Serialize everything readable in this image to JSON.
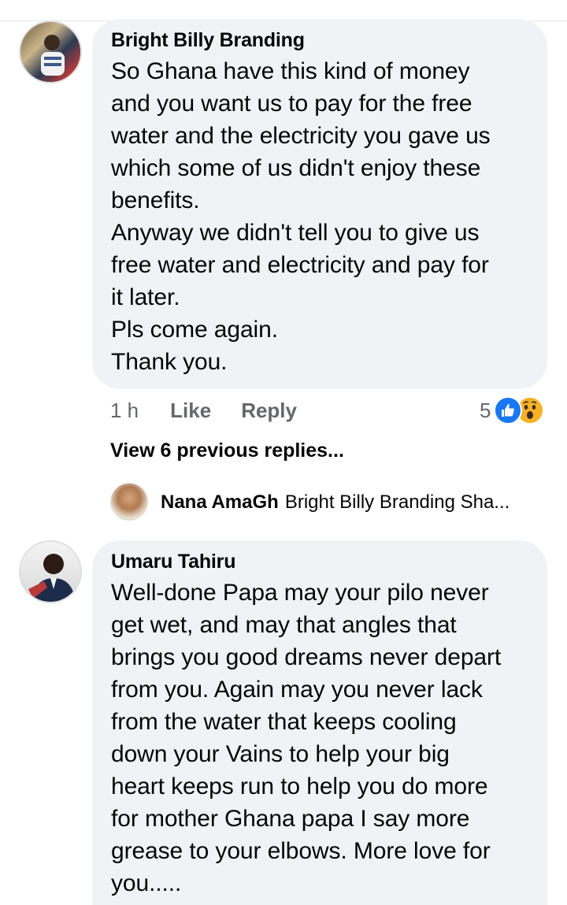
{
  "comment1": {
    "author": "Bright Billy Branding",
    "text": "So Ghana have this kind of money\nand you want us to pay for the free\nwater and the electricity you gave us\nwhich some of us didn't enjoy these\nbenefits.\nAnyway we didn't tell you to give us\nfree water and electricity and pay for\nit later.\nPls come again.\nThank you.",
    "time": "1 h",
    "like_label": "Like",
    "reply_label": "Reply",
    "reaction_count": "5"
  },
  "view_replies_label": "View 6 previous replies...",
  "reply_preview": {
    "author": "Nana AmaGh",
    "text": "Bright Billy Branding Sha..."
  },
  "comment2": {
    "author": "Umaru Tahiru",
    "text": "Well-done Papa may your pilo never\nget wet, and may that angles that\nbrings you good dreams never depart\nfrom you. Again may you never lack\nfrom the water that keeps cooling\ndown your Vains to help your big\nheart keeps run to help you do more\nfor mother Ghana papa I say more\ngrease to your elbows. More love for\nyou....."
  },
  "colors": {
    "bubble": "#f0f2f5",
    "meta_text": "#65676b",
    "like_blue": "#1877f2",
    "wow_yellow": "#f7b125"
  }
}
